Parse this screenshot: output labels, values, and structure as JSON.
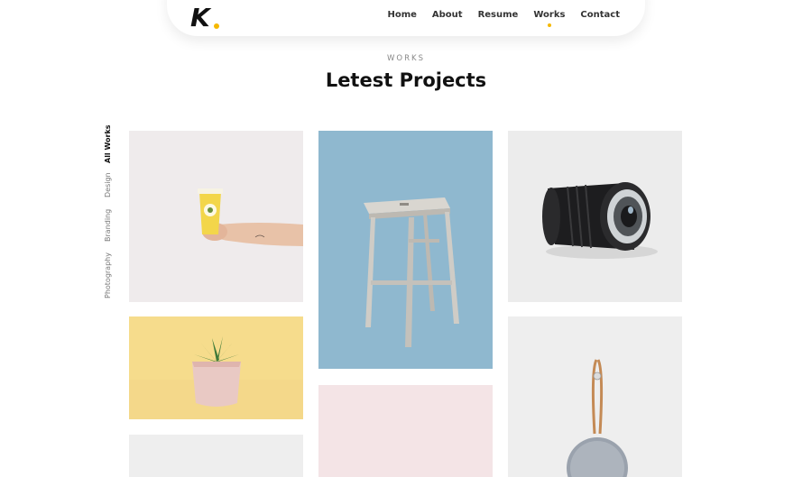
{
  "header": {
    "logo_letter": "K",
    "nav": [
      {
        "label": "Home",
        "active": false
      },
      {
        "label": "About",
        "active": false
      },
      {
        "label": "Resume",
        "active": false
      },
      {
        "label": "Works",
        "active": true
      },
      {
        "label": "Contact",
        "active": false
      }
    ]
  },
  "section": {
    "eyebrow": "WORKS",
    "title": "Letest Projects"
  },
  "filters": [
    {
      "label": "All Works",
      "active": true
    },
    {
      "label": "Design",
      "active": false
    },
    {
      "label": "Branding",
      "active": false
    },
    {
      "label": "Photography",
      "active": false
    }
  ],
  "projects": [
    {
      "name": "hand-holding-cup"
    },
    {
      "name": "wooden-stool"
    },
    {
      "name": "camera-lens"
    },
    {
      "name": "succulent-pot"
    },
    {
      "name": "pink-blank"
    },
    {
      "name": "hanging-speaker"
    },
    {
      "name": "gray-blank"
    }
  ],
  "colors": {
    "accent": "#f5b800",
    "text": "#111111",
    "muted": "#888888"
  }
}
